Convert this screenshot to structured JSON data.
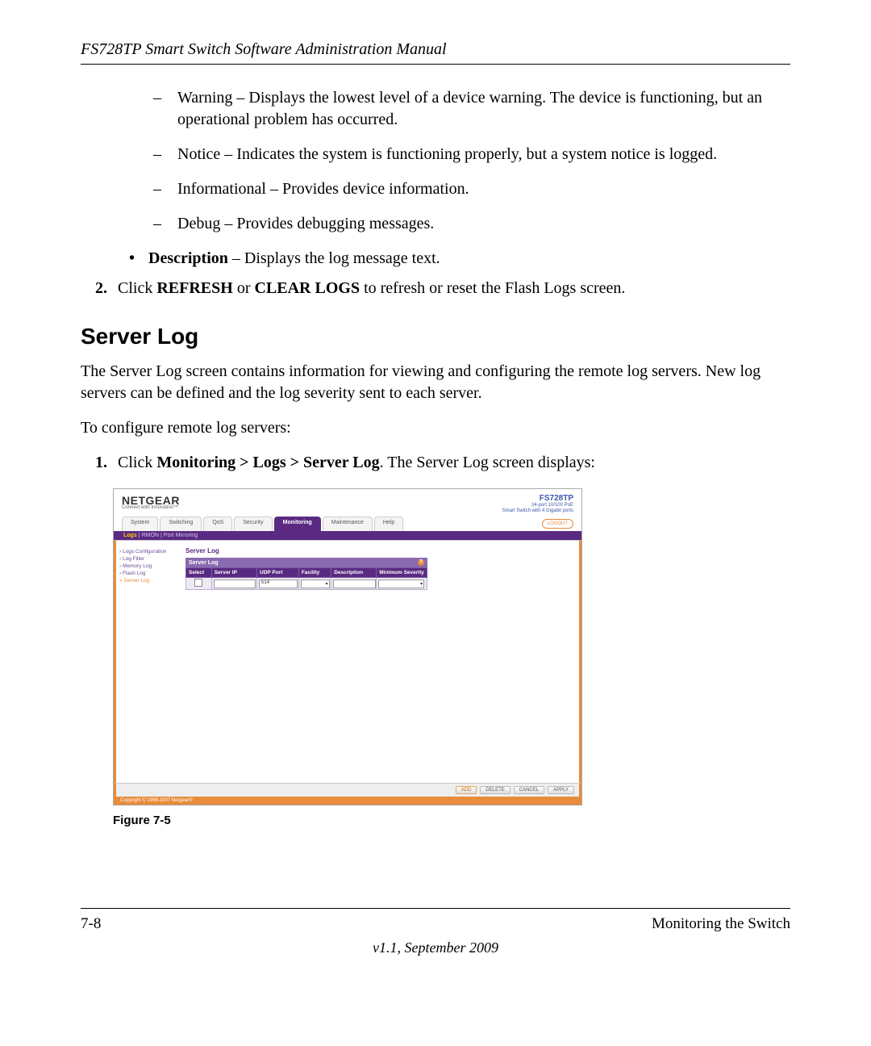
{
  "header": "FS728TP Smart Switch Software Administration Manual",
  "dash_items": [
    "Warning – Displays the lowest level of a device warning. The device is functioning, but an operational problem has occurred.",
    "Notice – Indicates the system is functioning properly, but a system notice is logged.",
    "Informational – Provides device information.",
    "Debug – Provides debugging messages."
  ],
  "bullet_item": {
    "bold": "Description",
    "rest": " – Displays the log message text."
  },
  "step2": {
    "num": "2.",
    "pre": "Click ",
    "b1": "REFRESH",
    "mid": " or ",
    "b2": "CLEAR LOGS",
    "post": " to refresh or reset the Flash Logs screen."
  },
  "section_title": "Server Log",
  "para1": "The Server Log screen contains information for viewing and configuring the remote log servers. New log servers can be defined and the log severity sent to each server.",
  "para2": "To configure remote log servers:",
  "step1b": {
    "num": "1.",
    "pre": "Click ",
    "b1": "Monitoring > Logs > Server Log",
    "post": ". The Server Log screen displays:"
  },
  "screenshot": {
    "brand": "NETGEAR",
    "brand_sub": "Connect with Innovation™",
    "model": "FS728TP",
    "model_sub1": "24-port 10/100 PoE",
    "model_sub2": "Smart Switch with 4 Gigabit ports",
    "tabs": [
      "System",
      "Switching",
      "QoS",
      "Security",
      "Monitoring",
      "Maintenance",
      "Help"
    ],
    "active_tab": "Monitoring",
    "logout": "LOGOUT",
    "subtabs": [
      "Logs",
      "RMON",
      "Port Mirroring"
    ],
    "active_subtab": "Logs",
    "sidebar": [
      "Logs Configuration",
      "Log Filter",
      "Memory Log",
      "Flash Log",
      "Server Log"
    ],
    "sidebar_selected": "Server Log",
    "panel_title": "Server Log",
    "panel_head": "Server Log",
    "columns": [
      "Select",
      "Server IP",
      "UDP Port",
      "Facility",
      "Description",
      "Minimum Severity"
    ],
    "row": {
      "udp_port": "514"
    },
    "buttons": [
      "ADD",
      "DELETE",
      "CANCEL",
      "APPLY"
    ],
    "copyright": "Copyright © 1996-2007 Netgear®"
  },
  "figure_caption": "Figure 7-5",
  "footer_left": "7-8",
  "footer_right": "Monitoring the Switch",
  "footer_center": "v1.1, September 2009"
}
